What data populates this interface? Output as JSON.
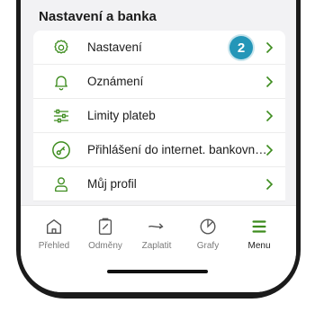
{
  "section": {
    "title": "Nastavení a banka"
  },
  "menu": {
    "items": [
      {
        "label": "Nastavení",
        "icon": "gear-icon"
      },
      {
        "label": "Oznámení",
        "icon": "bell-icon"
      },
      {
        "label": "Limity plateb",
        "icon": "sliders-icon"
      },
      {
        "label": "Přihlášení do internet. bankovn…",
        "icon": "key-icon"
      },
      {
        "label": "Můj profil",
        "icon": "user-icon"
      }
    ],
    "badge": "2"
  },
  "tabbar": {
    "tabs": [
      {
        "label": "Přehled",
        "icon": "home-icon"
      },
      {
        "label": "Odměny",
        "icon": "rewards-icon"
      },
      {
        "label": "Zaplatit",
        "icon": "pay-arrow-icon"
      },
      {
        "label": "Grafy",
        "icon": "chart-icon"
      },
      {
        "label": "Menu",
        "icon": "menu-icon"
      }
    ],
    "active": "Menu"
  },
  "colors": {
    "accent": "#3d8c1e",
    "badge": "#2496b8",
    "background": "#f2f2f4"
  }
}
